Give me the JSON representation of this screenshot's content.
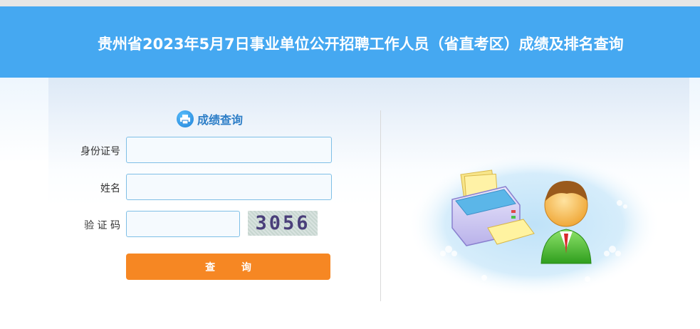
{
  "header": {
    "title": "贵州省2023年5月7日事业单位公开招聘工作人员（省直考区）成绩及排名查询"
  },
  "form": {
    "heading": "成绩查询",
    "heading_icon": "printer-icon",
    "fields": {
      "id_label": "身份证号",
      "id_value": "",
      "name_label": "姓名",
      "name_value": "",
      "captcha_label": "验 证 码",
      "captcha_value": ""
    },
    "captcha_image_text": "3056",
    "submit_label": "查 询"
  },
  "illustration": {
    "icon": "printer-user-illustration"
  },
  "colors": {
    "header_bg": "#45a8f1",
    "accent": "#f68723",
    "heading_text": "#2d7ec7",
    "input_border": "#7fbfe6"
  }
}
